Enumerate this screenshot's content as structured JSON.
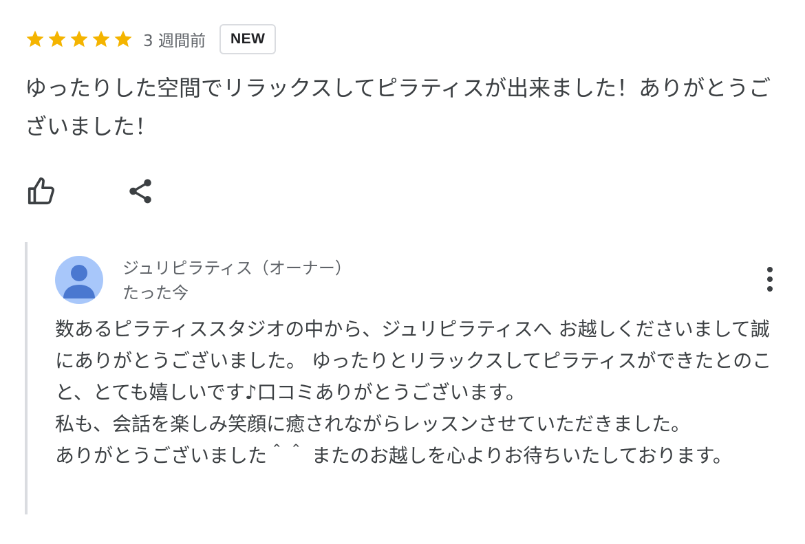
{
  "review": {
    "rating": 5,
    "max_rating": 5,
    "star_color": "#f4b400",
    "time_ago": "3 週間前",
    "badge": "NEW",
    "text": "ゆったりした空間でリラックスしてピラティスが出来ました！ありがとうございました！"
  },
  "actions": {
    "like_icon": "thumbs-up-icon",
    "share_icon": "share-icon"
  },
  "owner_reply": {
    "name": "ジュリピラティス（オーナー）",
    "time": "たった今",
    "avatar_color": "#a8c7fa",
    "avatar_fg_color": "#4a78d0",
    "menu_icon": "more-vert-icon",
    "text": "数あるピラティススタジオの中から、ジュリピラティスへ お越しくださいまして誠にありがとうございました。 ゆったりとリラックスしてピラティスができたとのこと、とても嬉しいです♪口コミありがとうございます。\n私も、会話を楽しみ笑顔に癒されながらレッスンさせていただきました。\nありがとうございました＾＾ またのお越しを心よりお待ちいたしております。"
  }
}
